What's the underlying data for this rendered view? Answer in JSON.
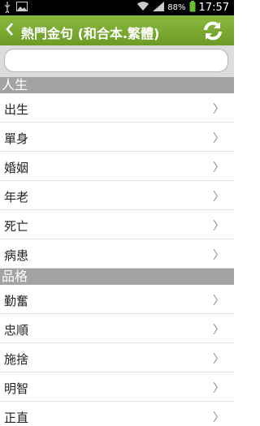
{
  "status": {
    "battery_pct": "88%",
    "time": "17:57"
  },
  "header": {
    "title": "熱門金句 (和合本.繁體)"
  },
  "search": {
    "placeholder": ""
  },
  "sections": [
    {
      "title": "人生",
      "items": [
        "出生",
        "單身",
        "婚姻",
        "年老",
        "死亡",
        "病患"
      ]
    },
    {
      "title": "品格",
      "items": [
        "勤奮",
        "忠順",
        "施捨",
        "明智",
        "正直"
      ]
    }
  ],
  "chevron": "〉",
  "colors": {
    "appbar": "#7aa832",
    "section": "#a3a3a3"
  }
}
